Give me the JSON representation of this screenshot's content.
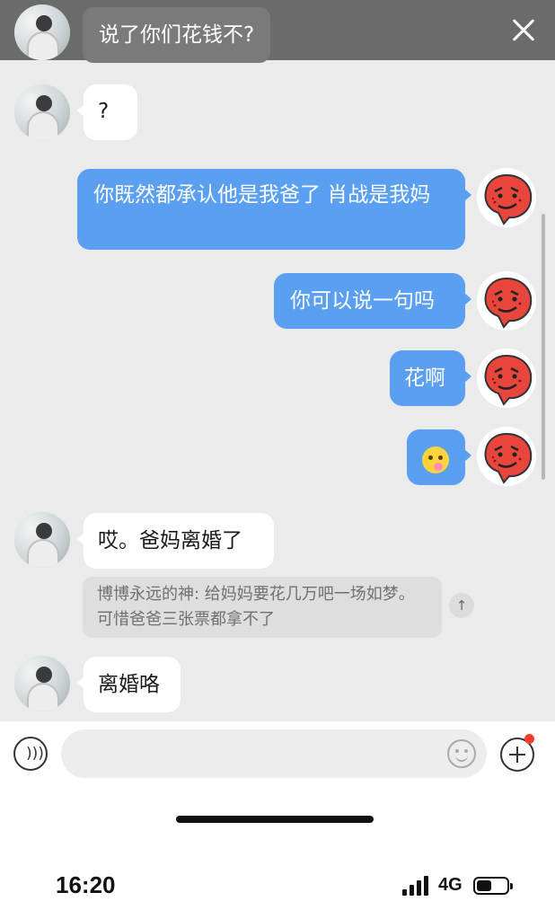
{
  "header": {
    "preview_message": "说了你们花钱不?"
  },
  "messages": [
    {
      "sender": "other",
      "text": "?"
    },
    {
      "sender": "me",
      "text": "你既然都承认他是我爸了 肖战是我妈"
    },
    {
      "sender": "me",
      "text": "你可以说一句吗"
    },
    {
      "sender": "me",
      "text": "花啊"
    },
    {
      "sender": "me",
      "text": "",
      "emoji": "drooling-face-emoji"
    },
    {
      "sender": "other",
      "text": "哎。爸妈离婚了"
    },
    {
      "sender": "other",
      "text": "离婚咯"
    }
  ],
  "quote": {
    "text": "博博永远的神: 给妈妈要花几万吧一场如梦。可惜爸爸三张票都拿不了",
    "up_icon": "↑"
  },
  "input": {
    "placeholder": "",
    "value": "",
    "voice_icon": "voice-icon",
    "emoji_icon": "emoji-icon",
    "plus_icon": "plus-icon",
    "badge_color": "#ff3b30"
  },
  "status_bar": {
    "time": "16:20",
    "network": "4G",
    "battery_level": 0.5
  },
  "colors": {
    "outgoing_bubble": "#5a9ff0",
    "incoming_bubble": "#ffffff",
    "chat_background": "#ebebeb"
  }
}
